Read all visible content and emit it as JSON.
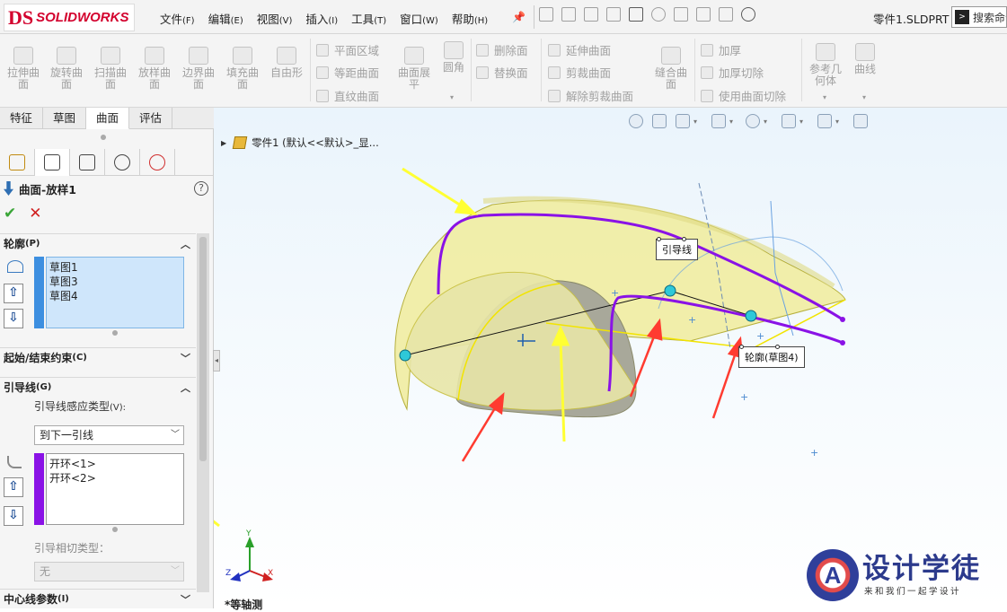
{
  "app": {
    "logo_mark": "DS",
    "logo_text": "SOLIDWORKS",
    "doc_name": "零件1.SLDPRT *",
    "search_label": "搜索命令"
  },
  "menus": [
    {
      "label": "文件",
      "key": "(F)"
    },
    {
      "label": "编辑",
      "key": "(E)"
    },
    {
      "label": "视图",
      "key": "(V)"
    },
    {
      "label": "插入",
      "key": "(I)"
    },
    {
      "label": "工具",
      "key": "(T)"
    },
    {
      "label": "窗口",
      "key": "(W)"
    },
    {
      "label": "帮助",
      "key": "(H)"
    }
  ],
  "ribbon": {
    "big": [
      {
        "label": "拉伸曲面",
        "icon": "extruded-surface-icon"
      },
      {
        "label": "旋转曲面",
        "icon": "revolved-surface-icon"
      },
      {
        "label": "扫描曲面",
        "icon": "swept-surface-icon"
      },
      {
        "label": "放样曲面",
        "icon": "lofted-surface-icon"
      },
      {
        "label": "边界曲面",
        "icon": "boundary-surface-icon"
      },
      {
        "label": "填充曲面",
        "icon": "filled-surface-icon"
      },
      {
        "label": "自由形",
        "icon": "freeform-icon"
      }
    ],
    "col1": [
      "平面区域",
      "等距曲面",
      "直纹曲面"
    ],
    "expand": "曲面展平",
    "fillet": "圆角",
    "col2": [
      "删除面",
      "替换面"
    ],
    "col3": [
      "延伸曲面",
      "剪裁曲面",
      "解除剪裁曲面"
    ],
    "knit": "缝合曲面",
    "col4": [
      "加厚",
      "加厚切除",
      "使用曲面切除"
    ],
    "refgeo": "参考几何体",
    "curves": "曲线"
  },
  "tabs": [
    "特征",
    "草图",
    "曲面",
    "评估"
  ],
  "active_tab": "曲面",
  "panel": {
    "title": "曲面-放样1",
    "help": "?",
    "ok": "✔",
    "cancel": "✕",
    "profiles_header": "轮廓",
    "profiles_key": "(P)",
    "profiles": [
      "草图1",
      "草图3",
      "草图4"
    ],
    "constraints_header": "起始/结束约束",
    "constraints_key": "(C)",
    "guides_header": "引导线",
    "guides_key": "(G)",
    "guide_influence_label": "引导线感应类型",
    "guide_influence_key": "(V):",
    "guide_influence_value": "到下一引线",
    "guides": [
      "开环<1>",
      "开环<2>"
    ],
    "guide_tangency_label": "引导相切类型：",
    "guide_tangency_value": "无",
    "centerline_header": "中心线参数",
    "centerline_key": "(I)"
  },
  "viewport": {
    "tree_item": "零件1  (默认<<默认>_显...",
    "callout_guide": "引导线",
    "callout_profile": "轮廓(草图4)",
    "view_name": "*等轴测",
    "axis_x": "X",
    "axis_y": "Y",
    "axis_z": "Z"
  },
  "watermark": {
    "mark": "A",
    "title": "设计学徒",
    "subtitle": "来和我们一起学设计"
  },
  "colors": {
    "accent": "#3d8fe0",
    "guide_purple": "#8a12e6",
    "surface_yellow": "#f2f0a0",
    "annot_red": "#ff3b30",
    "annot_yellow": "#ffff33"
  }
}
